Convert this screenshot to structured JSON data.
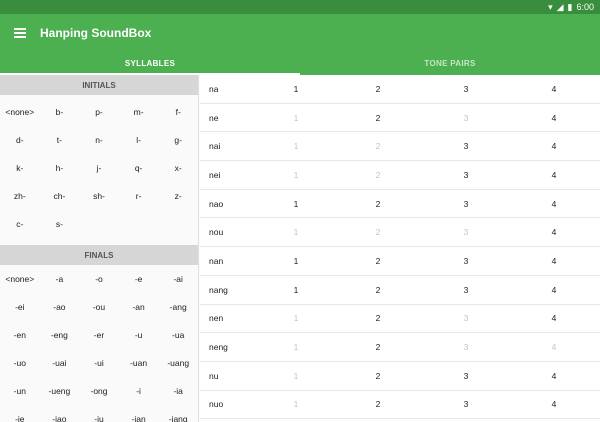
{
  "status": {
    "time": "6:00"
  },
  "app": {
    "title": "Hanping SoundBox"
  },
  "tabs": [
    {
      "label": "SYLLABLES"
    },
    {
      "label": "TONE PAIRS"
    }
  ],
  "initials": {
    "header": "INITIALS",
    "items": [
      "<none>",
      "b-",
      "p-",
      "m-",
      "f-",
      "d-",
      "t-",
      "n-",
      "l-",
      "g-",
      "k-",
      "h-",
      "j-",
      "q-",
      "x-",
      "zh-",
      "ch-",
      "sh-",
      "r-",
      "z-",
      "c-",
      "s-"
    ]
  },
  "finals": {
    "header": "FINALS",
    "items": [
      "<none>",
      "-a",
      "-o",
      "-e",
      "-ai",
      "-ei",
      "-ao",
      "-ou",
      "-an",
      "-ang",
      "-en",
      "-eng",
      "-er",
      "-u",
      "-ua",
      "-uo",
      "-uai",
      "-ui",
      "-uan",
      "-uang",
      "-un",
      "-ueng",
      "-ong",
      "-i",
      "-ia",
      "-ie",
      "-iao",
      "-iu",
      "-ian",
      "-iang"
    ]
  },
  "syllables": [
    {
      "syllable": "na",
      "tones": [
        "1",
        "2",
        "3",
        "4"
      ],
      "available": [
        true,
        true,
        true,
        true
      ]
    },
    {
      "syllable": "ne",
      "tones": [
        "1",
        "2",
        "3",
        "4"
      ],
      "available": [
        false,
        true,
        false,
        true
      ]
    },
    {
      "syllable": "nai",
      "tones": [
        "1",
        "2",
        "3",
        "4"
      ],
      "available": [
        false,
        false,
        true,
        true
      ]
    },
    {
      "syllable": "nei",
      "tones": [
        "1",
        "2",
        "3",
        "4"
      ],
      "available": [
        false,
        false,
        true,
        true
      ]
    },
    {
      "syllable": "nao",
      "tones": [
        "1",
        "2",
        "3",
        "4"
      ],
      "available": [
        true,
        true,
        true,
        true
      ]
    },
    {
      "syllable": "nou",
      "tones": [
        "1",
        "2",
        "3",
        "4"
      ],
      "available": [
        false,
        false,
        false,
        true
      ]
    },
    {
      "syllable": "nan",
      "tones": [
        "1",
        "2",
        "3",
        "4"
      ],
      "available": [
        true,
        true,
        true,
        true
      ]
    },
    {
      "syllable": "nang",
      "tones": [
        "1",
        "2",
        "3",
        "4"
      ],
      "available": [
        true,
        true,
        true,
        true
      ]
    },
    {
      "syllable": "nen",
      "tones": [
        "1",
        "2",
        "3",
        "4"
      ],
      "available": [
        false,
        true,
        false,
        true
      ]
    },
    {
      "syllable": "neng",
      "tones": [
        "1",
        "2",
        "3",
        "4"
      ],
      "available": [
        false,
        true,
        false,
        false
      ]
    },
    {
      "syllable": "nu",
      "tones": [
        "1",
        "2",
        "3",
        "4"
      ],
      "available": [
        false,
        true,
        true,
        true
      ]
    },
    {
      "syllable": "nuo",
      "tones": [
        "1",
        "2",
        "3",
        "4"
      ],
      "available": [
        false,
        true,
        true,
        true
      ]
    }
  ]
}
